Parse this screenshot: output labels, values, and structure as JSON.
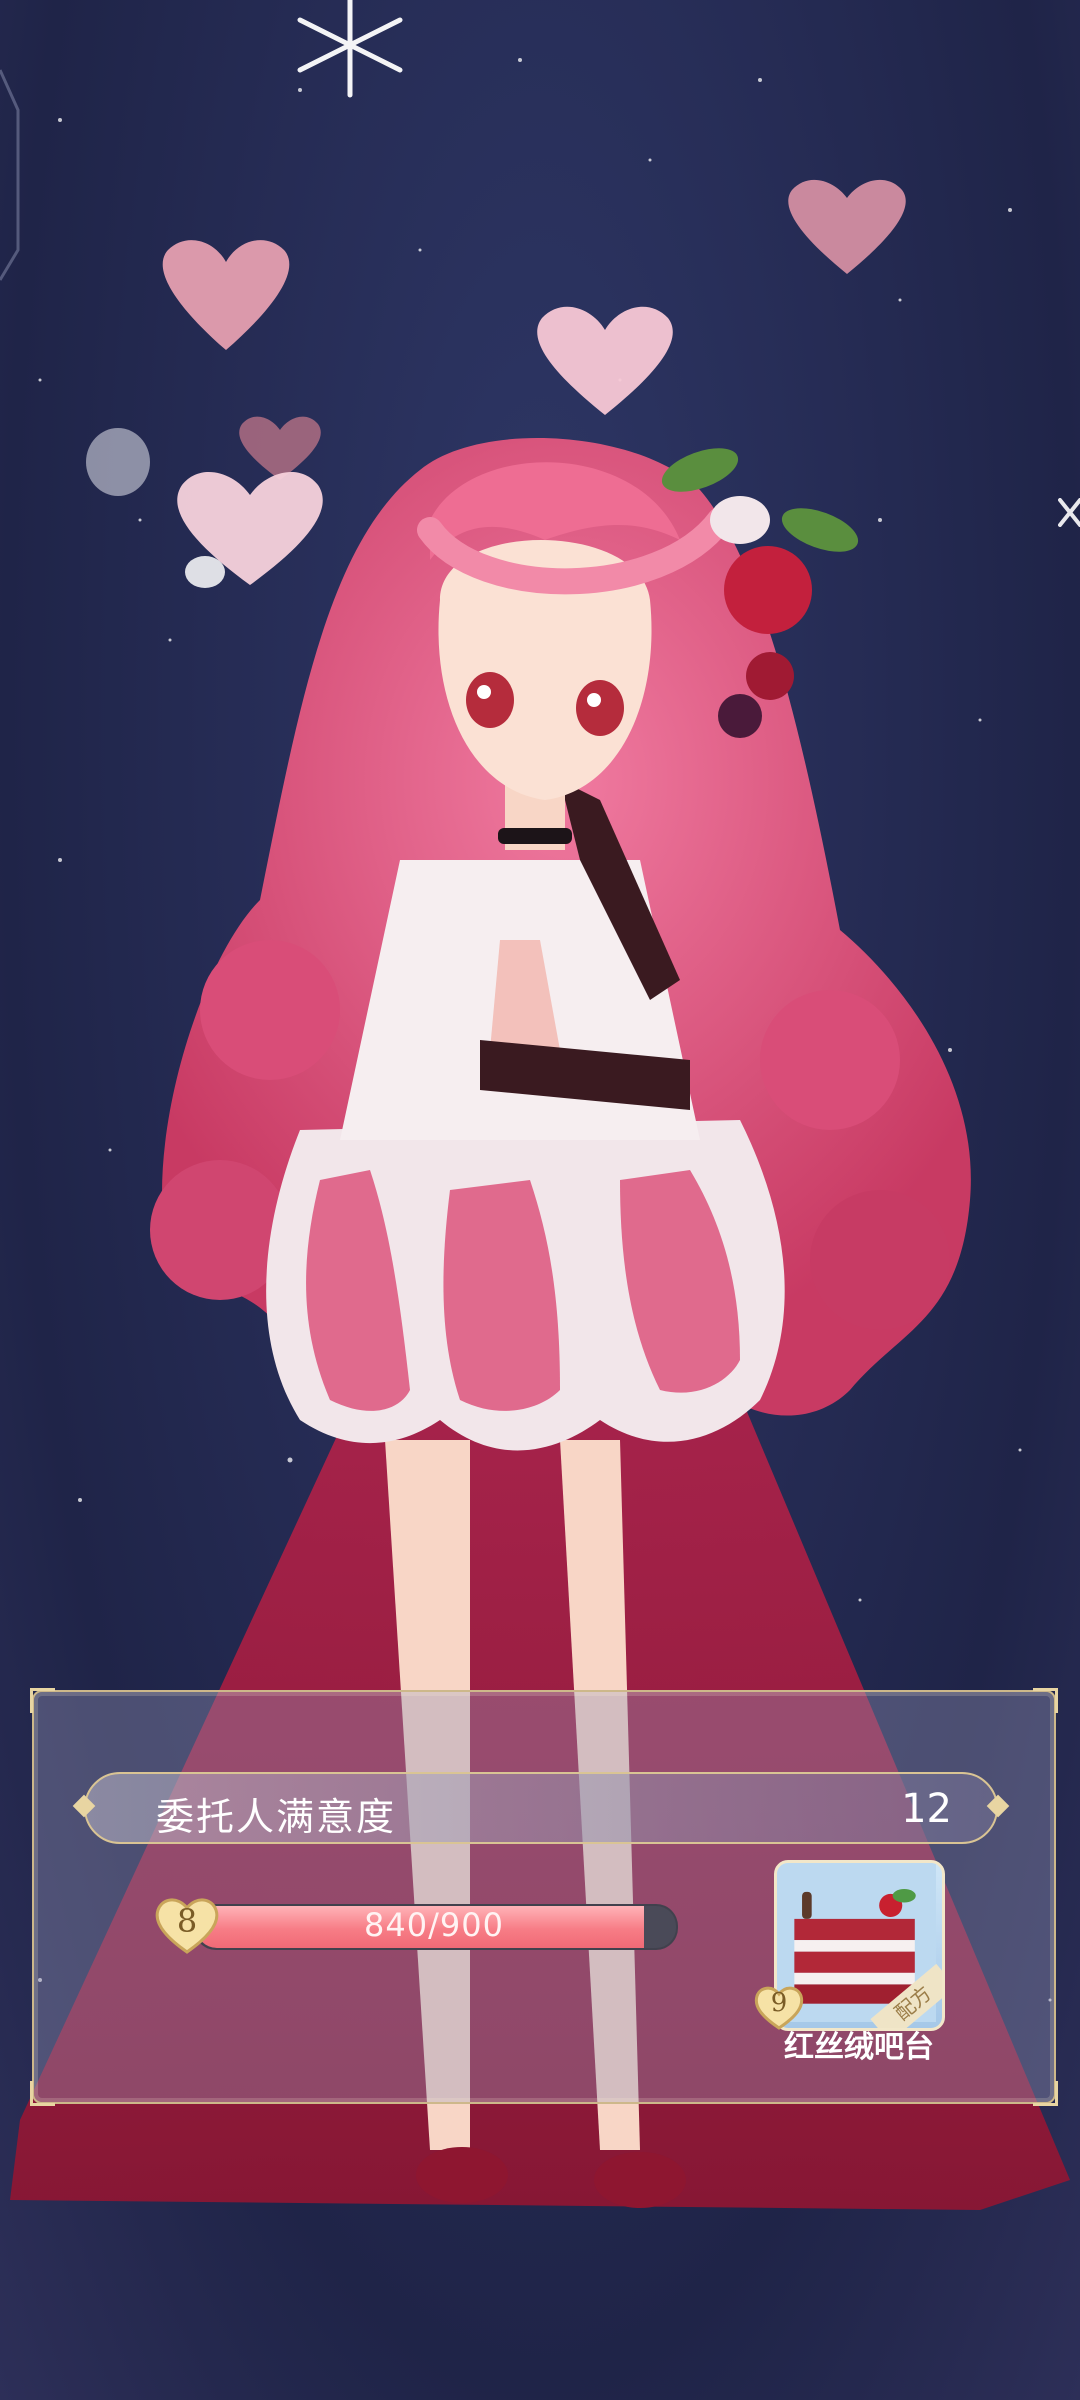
{
  "satisfaction": {
    "label": "委托人满意度",
    "value": "12"
  },
  "progress": {
    "level": "8",
    "current": 840,
    "max": 900,
    "text": "840/900"
  },
  "reward": {
    "level": "9",
    "tag": "配方",
    "name": "红丝绒吧台",
    "icon": "red-velvet-cake-icon"
  },
  "colors": {
    "sky": "#262c55",
    "hair": "#e4567f",
    "xp_fill": "#f77d86",
    "panel_border": "#cdb88a"
  }
}
